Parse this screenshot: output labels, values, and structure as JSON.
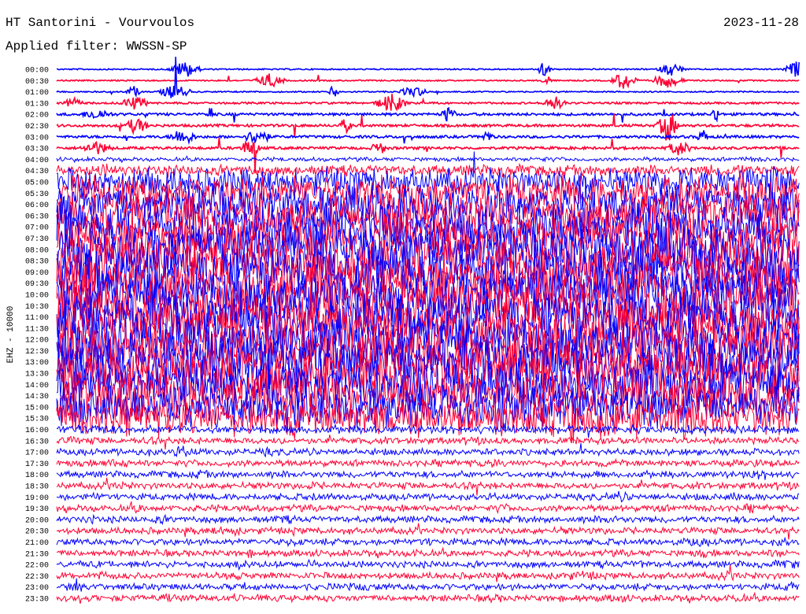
{
  "chart_data": {
    "type": "line",
    "title": "HT Santorini - Vourvoulos",
    "subtitle": "Applied filter: WWSSN-SP",
    "date": "2023-11-28",
    "ylabel": "EHZ - 10000",
    "xlabel": "",
    "colors": [
      "#0000ff",
      "#ff0033"
    ],
    "traces": [
      "00:00",
      "00:30",
      "01:00",
      "01:30",
      "02:00",
      "02:30",
      "03:00",
      "03:30",
      "04:00",
      "04:30",
      "05:00",
      "05:30",
      "06:00",
      "06:30",
      "07:00",
      "07:30",
      "08:00",
      "08:30",
      "09:00",
      "09:30",
      "10:00",
      "10:30",
      "11:00",
      "11:30",
      "12:00",
      "12:30",
      "13:00",
      "13:30",
      "14:00",
      "14:30",
      "15:00",
      "15:30",
      "16:00",
      "16:30",
      "17:00",
      "17:30",
      "18:00",
      "18:30",
      "19:00",
      "19:30",
      "20:00",
      "20:30",
      "21:00",
      "21:30",
      "22:00",
      "22:30",
      "23:00",
      "23:30"
    ],
    "relative_amplitude": [
      1,
      1,
      1,
      1.5,
      2,
      2,
      2,
      2,
      3,
      8,
      20,
      25,
      28,
      30,
      32,
      34,
      36,
      36,
      38,
      38,
      38,
      38,
      38,
      38,
      38,
      38,
      38,
      36,
      34,
      32,
      30,
      26,
      6,
      5,
      5,
      5,
      5,
      5,
      5,
      5,
      5,
      5,
      5,
      5,
      5,
      5,
      5,
      5
    ]
  }
}
